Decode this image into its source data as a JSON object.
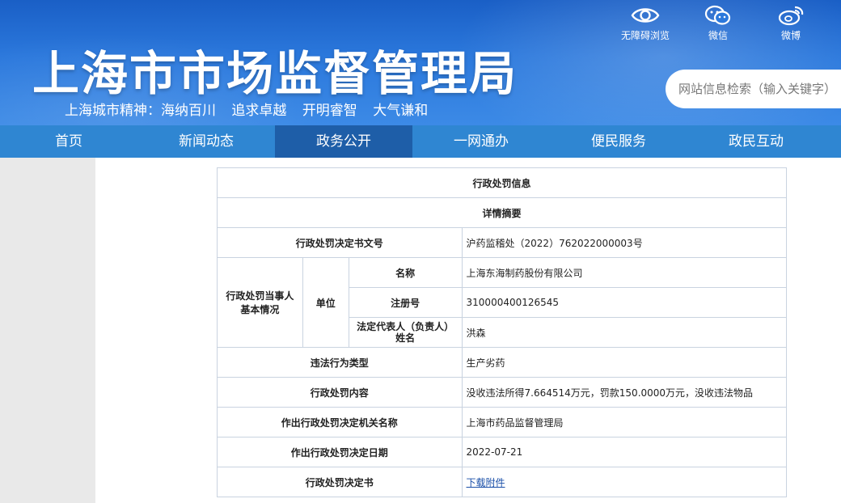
{
  "header": {
    "title": "上海市市场监督管理局",
    "slogan": [
      "上海城市精神：海纳百川",
      "追求卓越",
      "开明睿智",
      "大气谦和"
    ],
    "tools": [
      {
        "label": "无障碍浏览",
        "icon": "eye-icon"
      },
      {
        "label": "微信",
        "icon": "wechat-icon"
      },
      {
        "label": "微博",
        "icon": "weibo-icon"
      }
    ],
    "search_placeholder": "网站信息检索（输入关键字）",
    "search_value": ""
  },
  "nav": {
    "items": [
      "首页",
      "新闻动态",
      "政务公开",
      "一网通办",
      "便民服务",
      "政民互动"
    ],
    "active": "政务公开"
  },
  "table": {
    "title": "行政处罚信息",
    "subtitle": "详情摘要",
    "doc_no_label": "行政处罚决定书文号",
    "doc_no_value": "沪药监稽处（2022）762022000003号",
    "party_label": "行政处罚当事人基本情况",
    "unit_label": "单位",
    "name_label": "名称",
    "name_value": "上海东海制药股份有限公司",
    "reg_label": "注册号",
    "reg_value": "310000400126545",
    "rep_label": "法定代表人（负责人）姓名",
    "rep_value": "洪森",
    "violation_label": "违法行为类型",
    "violation_value": "生产劣药",
    "penalty_label": "行政处罚内容",
    "penalty_value": "没收违法所得7.664514万元，罚款150.0000万元，没收违法物品",
    "authority_label": "作出行政处罚决定机关名称",
    "authority_value": "上海市药品监督管理局",
    "date_label": "作出行政处罚决定日期",
    "date_value": "2022-07-21",
    "decision_label": "行政处罚决定书",
    "decision_link": "下载附件"
  }
}
